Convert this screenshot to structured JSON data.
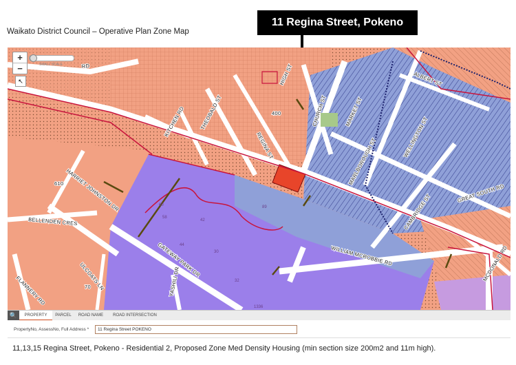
{
  "heading": "Waikato District Council – Operative Plan Zone Map",
  "callout": "11 Regina Street, Pokeno",
  "map": {
    "colors": {
      "residential": "#f2a183",
      "business": "#8fa0d8",
      "industrial": "#9b7fea",
      "rural": "#f5b28c",
      "road": "#ffffff",
      "boundary": "#c8143c",
      "highlight": "#e8452a"
    },
    "road_labels": [
      "ALBERT ST",
      "HIGH ST",
      "CHURCH ST",
      "MARKET ST",
      "KITCHEN RD",
      "THEOBALD ST",
      "REGINA ST",
      "WELLINGTON ST",
      "MARLBOROUGH ST",
      "CAMBRIDGE ST",
      "GREAT SOUTH RD",
      "HARRIET JOHNSTON DR",
      "BELLENDEN CRES",
      "GATEWAY PARK DR",
      "WILLIAM MCROBBIE RD",
      "ULCOATS LN",
      "YASHILI DR",
      "FLANNERY RD",
      "MCDONALD RD",
      "RD"
    ],
    "parcel_numbers": [
      "400",
      "610",
      "70",
      "89",
      "1336",
      "42",
      "30",
      "44",
      "58",
      "60",
      "32"
    ],
    "zoom_in": "+",
    "zoom_out": "−",
    "slider_text": "SMALL SCALE"
  },
  "tabs": [
    "PROPERTY",
    "PARCEL",
    "ROAD NAME",
    "ROAD INTERSECTION"
  ],
  "active_tab": "PROPERTY",
  "search_icon": "search-icon",
  "address_label": "PropertyNo, AssessNo, Full Address *",
  "address_value": "11 Regina Street POKENO",
  "caption": "11,13,15 Regina Street, Pokeno - Residential 2, Proposed Zone Med Density Housing (min section size 200m2 and 11m high)."
}
